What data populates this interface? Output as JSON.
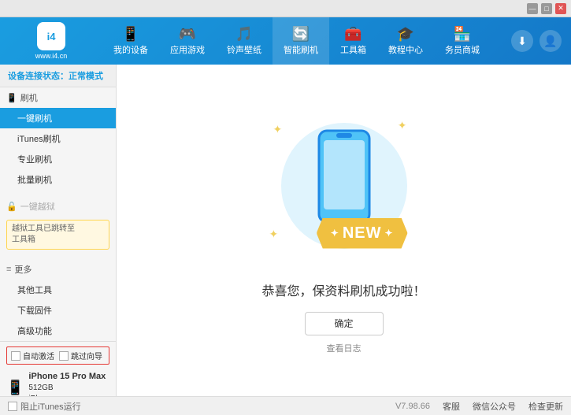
{
  "topbar": {
    "icons": [
      "minimize",
      "maximize",
      "close"
    ]
  },
  "header": {
    "logo": {
      "symbol": "i4",
      "url": "www.i4.cn"
    },
    "nav": [
      {
        "id": "my-device",
        "icon": "📱",
        "label": "我的设备"
      },
      {
        "id": "app-games",
        "icon": "🎮",
        "label": "应用游戏"
      },
      {
        "id": "ringtone",
        "icon": "🔔",
        "label": "铃声壁纸"
      },
      {
        "id": "smart-flash",
        "icon": "🔄",
        "label": "智能刷机"
      },
      {
        "id": "toolbox",
        "icon": "🧰",
        "label": "工具箱"
      },
      {
        "id": "tutorial",
        "icon": "🎓",
        "label": "教程中心"
      },
      {
        "id": "service",
        "icon": "🏪",
        "label": "务员商城"
      }
    ],
    "right_buttons": [
      "download",
      "user"
    ]
  },
  "sidebar": {
    "status_label": "设备连接状态：",
    "status_value": "正常模式",
    "sections": [
      {
        "id": "flash",
        "icon": "📱",
        "label": "刷机",
        "items": [
          {
            "id": "one-key-flash",
            "label": "一键刷机",
            "active": true
          },
          {
            "id": "itunes-flash",
            "label": "iTunes刷机",
            "active": false
          },
          {
            "id": "pro-flash",
            "label": "专业刷机",
            "active": false
          },
          {
            "id": "batch-flash",
            "label": "批量刷机",
            "active": false
          }
        ]
      },
      {
        "id": "one-key-jailbreak",
        "icon": "🔓",
        "label": "一键越狱",
        "disabled": true,
        "notice": "越狱工具已跳转至\n工具箱"
      },
      {
        "id": "more",
        "icon": "≡",
        "label": "更多",
        "items": [
          {
            "id": "other-tools",
            "label": "其他工具",
            "active": false
          },
          {
            "id": "download-firmware",
            "label": "下载固件",
            "active": false
          },
          {
            "id": "advanced",
            "label": "高级功能",
            "active": false
          }
        ]
      }
    ],
    "bottom": {
      "auto_activate_label": "自动激活",
      "time_guide_label": "跳过向导",
      "device_name": "iPhone 15 Pro Max",
      "device_storage": "512GB",
      "device_type": "iPhone"
    }
  },
  "content": {
    "success_message": "恭喜您，保资料刷机成功啦！",
    "confirm_button": "确定",
    "log_link": "查看日志",
    "new_label": "NEW"
  },
  "footer": {
    "stop_itunes_label": "阻止iTunes运行",
    "version": "V7.98.66",
    "links": [
      "客服",
      "微信公众号",
      "检查更新"
    ]
  }
}
